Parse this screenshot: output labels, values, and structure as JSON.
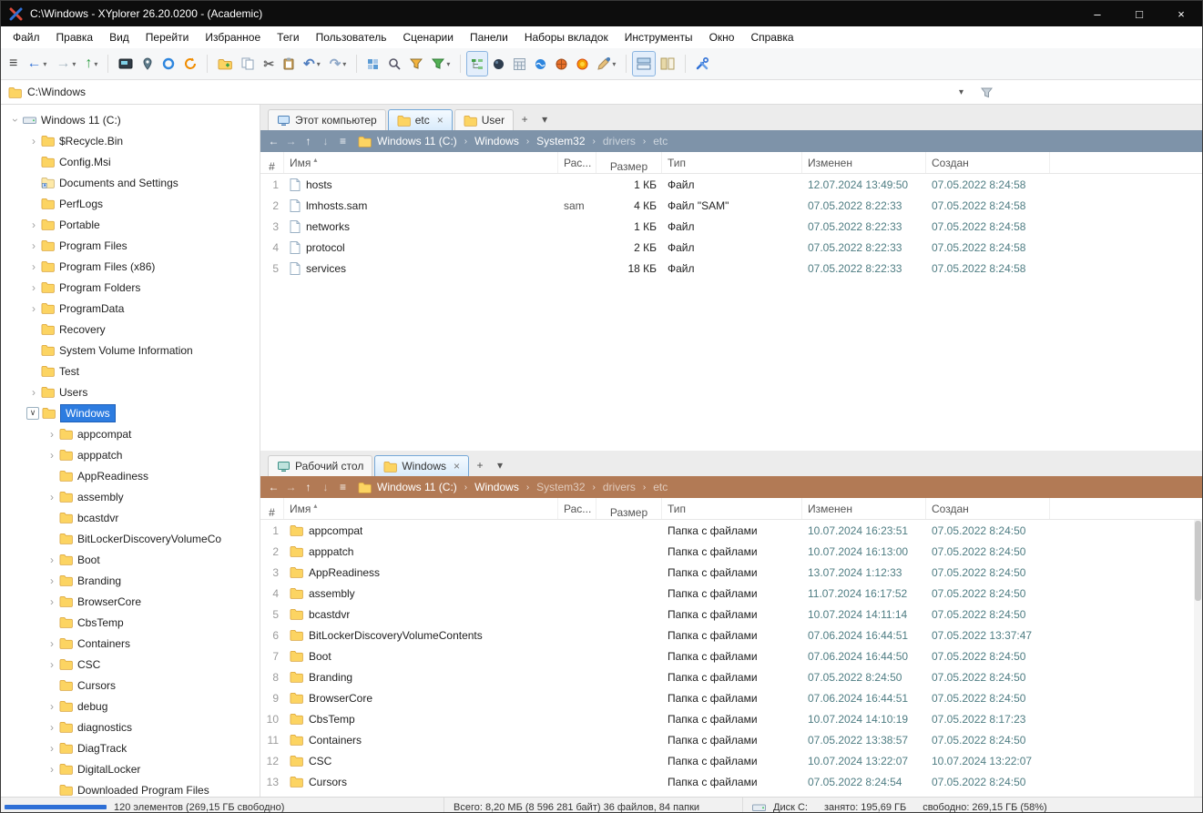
{
  "window": {
    "title": "C:\\Windows - XYplorer 26.20.0200 - (Academic)",
    "controls": {
      "minimize": "–",
      "maximize": "□",
      "close": "×"
    }
  },
  "menu": [
    "Файл",
    "Правка",
    "Вид",
    "Перейти",
    "Избранное",
    "Теги",
    "Пользователь",
    "Сценарии",
    "Панели",
    "Наборы вкладок",
    "Инструменты",
    "Окно",
    "Справка"
  ],
  "address": {
    "value": "C:\\Windows"
  },
  "ui": {
    "add_tab": "+",
    "tab_menu": "▾",
    "close": "×",
    "nav": [
      "←",
      "→",
      "↑",
      "↓"
    ],
    "crumb_sep": "›",
    "sort_asc": "▴",
    "crumb_menu": "≡"
  },
  "colors": {
    "selection_blue": "#2d7ce0",
    "crumb_top": "#7e93a9",
    "crumb_bottom": "#b27a55",
    "date_text": "#4f7d83",
    "status_graph_blue": "#2e6fd6"
  },
  "toolbar": [
    {
      "icon": "hamburger",
      "name": "main-menu-toggle-button"
    },
    {
      "icon": "back",
      "caret": true,
      "name": "back-button"
    },
    {
      "icon": "forward",
      "caret": true,
      "name": "forward-button"
    },
    {
      "icon": "up",
      "caret": true,
      "name": "up-button"
    },
    {
      "sep": true
    },
    {
      "icon": "screen",
      "name": "screen-button"
    },
    {
      "icon": "pin",
      "name": "location-pin-button"
    },
    {
      "icon": "zoom",
      "name": "zoom-button"
    },
    {
      "icon": "refresh",
      "name": "refresh-button"
    },
    {
      "sep": true
    },
    {
      "icon": "new-folder",
      "name": "new-folder-button"
    },
    {
      "icon": "copy",
      "name": "copy-button"
    },
    {
      "icon": "cut",
      "name": "cut-button"
    },
    {
      "icon": "paste",
      "name": "paste-button"
    },
    {
      "icon": "undo",
      "caret": true,
      "name": "undo-button"
    },
    {
      "icon": "redo",
      "caret": true,
      "name": "redo-button"
    },
    {
      "sep": true
    },
    {
      "icon": "tiles",
      "name": "views-button"
    },
    {
      "icon": "search",
      "name": "search-button"
    },
    {
      "icon": "funnel",
      "name": "filter-button"
    },
    {
      "icon": "funnel-green",
      "caret": true,
      "name": "visual-filter-button"
    },
    {
      "sep": true
    },
    {
      "icon": "tree-toggle",
      "active": true,
      "name": "tree-toggle-button"
    },
    {
      "icon": "sphere",
      "name": "sphere-button"
    },
    {
      "icon": "calc",
      "name": "calculator-button"
    },
    {
      "icon": "wave",
      "name": "wave-button"
    },
    {
      "icon": "basketball",
      "name": "basketball-button"
    },
    {
      "icon": "ball",
      "name": "ball-button"
    },
    {
      "icon": "brush",
      "caret": true,
      "name": "brush-button"
    },
    {
      "sep": true
    },
    {
      "icon": "pane-horizontal",
      "active": true,
      "name": "dual-pane-horizontal-button"
    },
    {
      "icon": "pane-vertical",
      "name": "dual-pane-vertical-button"
    },
    {
      "sep": true
    },
    {
      "icon": "wrench",
      "name": "tools-button"
    }
  ],
  "tree": {
    "items": [
      {
        "label": "Windows 11 (C:)",
        "level": 0,
        "exp": "open",
        "icon": "drive"
      },
      {
        "label": "$Recycle.Bin",
        "level": 1,
        "exp": "closed",
        "icon": "folder"
      },
      {
        "label": "Config.Msi",
        "level": 1,
        "exp": "none",
        "icon": "folder"
      },
      {
        "label": "Documents and Settings",
        "level": 1,
        "exp": "none",
        "icon": "folder-link"
      },
      {
        "label": "PerfLogs",
        "level": 1,
        "exp": "none",
        "icon": "folder"
      },
      {
        "label": "Portable",
        "level": 1,
        "exp": "closed",
        "icon": "folder"
      },
      {
        "label": "Program Files",
        "level": 1,
        "exp": "closed",
        "icon": "folder"
      },
      {
        "label": "Program Files (x86)",
        "level": 1,
        "exp": "closed",
        "icon": "folder"
      },
      {
        "label": "Program Folders",
        "level": 1,
        "exp": "closed",
        "icon": "folder"
      },
      {
        "label": "ProgramData",
        "level": 1,
        "exp": "closed",
        "icon": "folder"
      },
      {
        "label": "Recovery",
        "level": 1,
        "exp": "none",
        "icon": "folder"
      },
      {
        "label": "System Volume Information",
        "level": 1,
        "exp": "none",
        "icon": "folder"
      },
      {
        "label": "Test",
        "level": 1,
        "exp": "none",
        "icon": "folder"
      },
      {
        "label": "Users",
        "level": 1,
        "exp": "closed",
        "icon": "folder"
      },
      {
        "label": "Windows",
        "level": 1,
        "exp": "openbox",
        "icon": "folder",
        "selected": true
      },
      {
        "label": "appcompat",
        "level": 2,
        "exp": "closed",
        "icon": "folder"
      },
      {
        "label": "apppatch",
        "level": 2,
        "exp": "closed",
        "icon": "folder"
      },
      {
        "label": "AppReadiness",
        "level": 2,
        "exp": "none",
        "icon": "folder"
      },
      {
        "label": "assembly",
        "level": 2,
        "exp": "closed",
        "icon": "folder"
      },
      {
        "label": "bcastdvr",
        "level": 2,
        "exp": "none",
        "icon": "folder"
      },
      {
        "label": "BitLockerDiscoveryVolumeCo",
        "level": 2,
        "exp": "none",
        "icon": "folder"
      },
      {
        "label": "Boot",
        "level": 2,
        "exp": "closed",
        "icon": "folder"
      },
      {
        "label": "Branding",
        "level": 2,
        "exp": "closed",
        "icon": "folder"
      },
      {
        "label": "BrowserCore",
        "level": 2,
        "exp": "closed",
        "icon": "folder"
      },
      {
        "label": "CbsTemp",
        "level": 2,
        "exp": "none",
        "icon": "folder"
      },
      {
        "label": "Containers",
        "level": 2,
        "exp": "closed",
        "icon": "folder"
      },
      {
        "label": "CSC",
        "level": 2,
        "exp": "closed",
        "icon": "folder"
      },
      {
        "label": "Cursors",
        "level": 2,
        "exp": "none",
        "icon": "folder"
      },
      {
        "label": "debug",
        "level": 2,
        "exp": "closed",
        "icon": "folder"
      },
      {
        "label": "diagnostics",
        "level": 2,
        "exp": "closed",
        "icon": "folder"
      },
      {
        "label": "DiagTrack",
        "level": 2,
        "exp": "closed",
        "icon": "folder"
      },
      {
        "label": "DigitalLocker",
        "level": 2,
        "exp": "closed",
        "icon": "folder"
      },
      {
        "label": "Downloaded Program Files",
        "level": 2,
        "exp": "none",
        "icon": "folder"
      }
    ]
  },
  "panes": [
    {
      "id": "top",
      "crumb_color": "#7e93a9",
      "scrollbar": false,
      "tabs": [
        {
          "label": "Этот компьютер",
          "icon": "computer"
        },
        {
          "label": "etc",
          "icon": "folder",
          "active": true,
          "closable": true
        },
        {
          "label": "User",
          "icon": "folder"
        }
      ],
      "breadcrumb": [
        {
          "label": "Windows 11 (C:)",
          "dim": false
        },
        {
          "label": "Windows",
          "dim": false
        },
        {
          "label": "System32",
          "dim": false
        },
        {
          "label": "drivers",
          "dim": true
        },
        {
          "label": "etc",
          "dim": true
        }
      ],
      "columns": [
        {
          "label": "#",
          "align": "right"
        },
        {
          "label": "Имя",
          "sort": "asc"
        },
        {
          "label": "Рас..."
        },
        {
          "label": "Размер",
          "align": "right"
        },
        {
          "label": "Тип"
        },
        {
          "label": "Изменен"
        },
        {
          "label": "Создан"
        }
      ],
      "rows": [
        {
          "n": "1",
          "name": "hosts",
          "ext": "",
          "size": "1 КБ",
          "type": "Файл",
          "modified": "12.07.2024 13:49:50",
          "created": "07.05.2022 8:24:58",
          "icon": "file"
        },
        {
          "n": "2",
          "name": "lmhosts.sam",
          "ext": "sam",
          "size": "4 КБ",
          "type": "Файл \"SAM\"",
          "modified": "07.05.2022 8:22:33",
          "created": "07.05.2022 8:24:58",
          "icon": "file"
        },
        {
          "n": "3",
          "name": "networks",
          "ext": "",
          "size": "1 КБ",
          "type": "Файл",
          "modified": "07.05.2022 8:22:33",
          "created": "07.05.2022 8:24:58",
          "icon": "file"
        },
        {
          "n": "4",
          "name": "protocol",
          "ext": "",
          "size": "2 КБ",
          "type": "Файл",
          "modified": "07.05.2022 8:22:33",
          "created": "07.05.2022 8:24:58",
          "icon": "file"
        },
        {
          "n": "5",
          "name": "services",
          "ext": "",
          "size": "18 КБ",
          "type": "Файл",
          "modified": "07.05.2022 8:22:33",
          "created": "07.05.2022 8:24:58",
          "icon": "file"
        }
      ]
    },
    {
      "id": "bottom",
      "crumb_color": "#b27a55",
      "scrollbar": true,
      "tabs": [
        {
          "label": "Рабочий стол",
          "icon": "desktop"
        },
        {
          "label": "Windows",
          "icon": "folder",
          "active": true,
          "closable": true
        }
      ],
      "breadcrumb": [
        {
          "label": "Windows 11 (C:)",
          "dim": false
        },
        {
          "label": "Windows",
          "dim": false
        },
        {
          "label": "System32",
          "dim": true
        },
        {
          "label": "drivers",
          "dim": true
        },
        {
          "label": "etc",
          "dim": true
        }
      ],
      "columns": [
        {
          "label": "#",
          "align": "right"
        },
        {
          "label": "Имя",
          "sort": "asc"
        },
        {
          "label": "Рас..."
        },
        {
          "label": "Размер",
          "align": "right"
        },
        {
          "label": "Тип"
        },
        {
          "label": "Изменен"
        },
        {
          "label": "Создан"
        }
      ],
      "rows": [
        {
          "n": "1",
          "name": "appcompat",
          "ext": "",
          "size": "",
          "type": "Папка с файлами",
          "modified": "10.07.2024 16:23:51",
          "created": "07.05.2022 8:24:50",
          "icon": "folder"
        },
        {
          "n": "2",
          "name": "apppatch",
          "ext": "",
          "size": "",
          "type": "Папка с файлами",
          "modified": "10.07.2024 16:13:00",
          "created": "07.05.2022 8:24:50",
          "icon": "folder"
        },
        {
          "n": "3",
          "name": "AppReadiness",
          "ext": "",
          "size": "",
          "type": "Папка с файлами",
          "modified": "13.07.2024 1:12:33",
          "created": "07.05.2022 8:24:50",
          "icon": "folder"
        },
        {
          "n": "4",
          "name": "assembly",
          "ext": "",
          "size": "",
          "type": "Папка с файлами",
          "modified": "11.07.2024 16:17:52",
          "created": "07.05.2022 8:24:50",
          "icon": "folder"
        },
        {
          "n": "5",
          "name": "bcastdvr",
          "ext": "",
          "size": "",
          "type": "Папка с файлами",
          "modified": "10.07.2024 14:11:14",
          "created": "07.05.2022 8:24:50",
          "icon": "folder"
        },
        {
          "n": "6",
          "name": "BitLockerDiscoveryVolumeContents",
          "ext": "",
          "size": "",
          "type": "Папка с файлами",
          "modified": "07.06.2024 16:44:51",
          "created": "07.05.2022 13:37:47",
          "icon": "folder"
        },
        {
          "n": "7",
          "name": "Boot",
          "ext": "",
          "size": "",
          "type": "Папка с файлами",
          "modified": "07.06.2024 16:44:50",
          "created": "07.05.2022 8:24:50",
          "icon": "folder"
        },
        {
          "n": "8",
          "name": "Branding",
          "ext": "",
          "size": "",
          "type": "Папка с файлами",
          "modified": "07.05.2022 8:24:50",
          "created": "07.05.2022 8:24:50",
          "icon": "folder"
        },
        {
          "n": "9",
          "name": "BrowserCore",
          "ext": "",
          "size": "",
          "type": "Папка с файлами",
          "modified": "07.06.2024 16:44:51",
          "created": "07.05.2022 8:24:50",
          "icon": "folder"
        },
        {
          "n": "10",
          "name": "CbsTemp",
          "ext": "",
          "size": "",
          "type": "Папка с файлами",
          "modified": "10.07.2024 14:10:19",
          "created": "07.05.2022 8:17:23",
          "icon": "folder"
        },
        {
          "n": "11",
          "name": "Containers",
          "ext": "",
          "size": "",
          "type": "Папка с файлами",
          "modified": "07.05.2022 13:38:57",
          "created": "07.05.2022 8:24:50",
          "icon": "folder"
        },
        {
          "n": "12",
          "name": "CSC",
          "ext": "",
          "size": "",
          "type": "Папка с файлами",
          "modified": "10.07.2024 13:22:07",
          "created": "10.07.2024 13:22:07",
          "icon": "folder"
        },
        {
          "n": "13",
          "name": "Cursors",
          "ext": "",
          "size": "",
          "type": "Папка с файлами",
          "modified": "07.05.2022 8:24:54",
          "created": "07.05.2022 8:24:50",
          "icon": "folder"
        }
      ]
    }
  ],
  "statusbar": {
    "sections": [
      {
        "bar": true,
        "text": "120 элементов (269,15 ГБ свободно)"
      },
      {
        "text": "Всего: 8,20 МБ (8 596 281 байт) 36 файлов, 84 папки"
      },
      {
        "icon": "drive",
        "parts": [
          "Диск C:",
          "занято: 195,69 ГБ",
          "свободно: 269,15 ГБ (58%)"
        ]
      }
    ]
  }
}
